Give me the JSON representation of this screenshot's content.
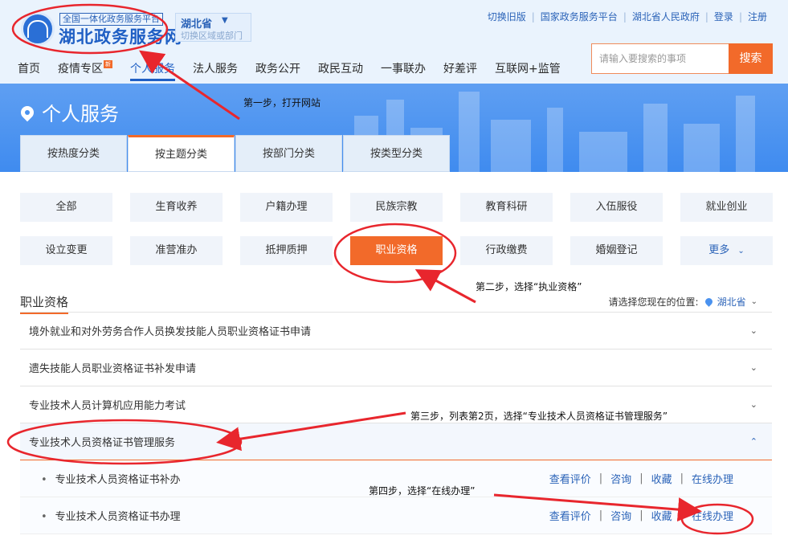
{
  "header": {
    "site_sub": "全国一体化政务服务平台",
    "site_name": "湖北政务服务网",
    "region": "湖北省",
    "region_switch": "切换区域或部门",
    "top_links": [
      "切换旧版",
      "国家政务服务平台",
      "湖北省人民政府",
      "登录",
      "注册"
    ],
    "search_placeholder": "请输入要搜索的事项",
    "search_button": "搜索",
    "nav": [
      "首页",
      "疫情专区",
      "个人服务",
      "法人服务",
      "政务公开",
      "政民互动",
      "一事联办",
      "好差评",
      "互联网+监管"
    ],
    "hot_badge": "新"
  },
  "page_title": "个人服务",
  "tabs": [
    "按热度分类",
    "按主题分类",
    "按部门分类",
    "按类型分类"
  ],
  "active_tab": 1,
  "categories": [
    "全部",
    "生育收养",
    "户籍办理",
    "民族宗教",
    "教育科研",
    "入伍服役",
    "就业创业",
    "设立变更",
    "准营准办",
    "抵押质押",
    "职业资格",
    "行政缴费",
    "婚姻登记",
    "更多"
  ],
  "section_title": "职业资格",
  "location": {
    "label": "请选择您现在的位置:",
    "region": "湖北省"
  },
  "items": [
    "境外就业和对外劳务合作人员换发技能人员职业资格证书申请",
    "遗失技能人员职业资格证书补发申请",
    "专业技术人员计算机应用能力考试",
    "专业技术人员资格证书管理服务"
  ],
  "sub_items": [
    {
      "title": "专业技术人员资格证书补办",
      "actions": [
        "查看评价",
        "咨询",
        "收藏",
        "在线办理"
      ]
    },
    {
      "title": "专业技术人员资格证书办理",
      "actions": [
        "查看评价",
        "咨询",
        "收藏",
        "在线办理"
      ]
    }
  ],
  "annotations": {
    "step1": "第一步，打开网站",
    "step2": "第二步，选择“执业资格”",
    "step3": "第三步，列表第2页，选择“专业技术人员资格证书管理服务”",
    "step4": "第四步，选择“在线办理”"
  },
  "colors": {
    "accent": "#f26a2a",
    "brand_blue": "#1f5fc4",
    "annotation_red": "#e8262d"
  }
}
